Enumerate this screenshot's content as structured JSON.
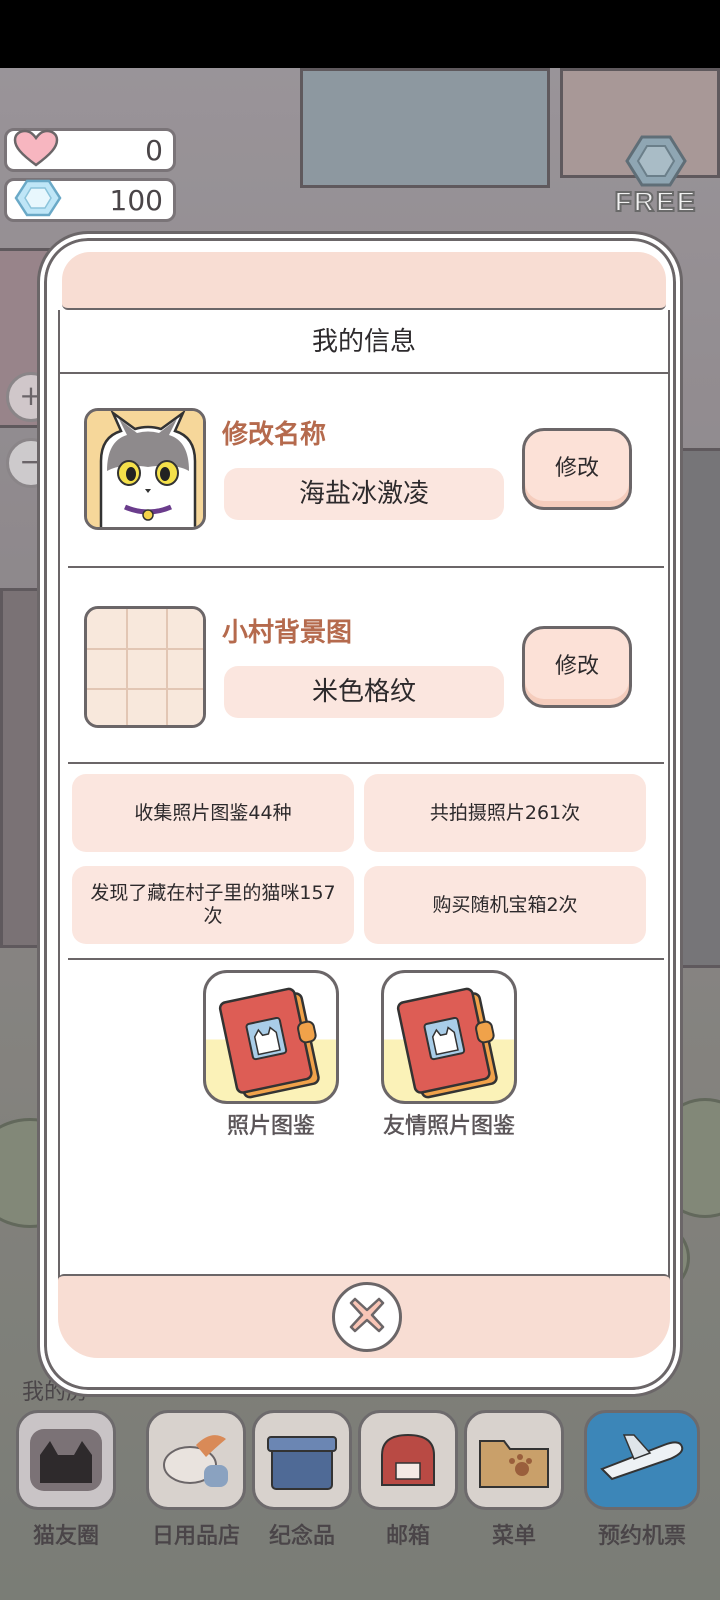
{
  "currency": {
    "hearts": {
      "icon": "heart-icon",
      "value": "0"
    },
    "gems": {
      "icon": "diamond-icon",
      "value": "100"
    },
    "free_label": "FREE"
  },
  "zoom": {
    "plus": "+",
    "minus": "−"
  },
  "modal": {
    "title": "我的信息",
    "name_setting": {
      "title": "修改名称",
      "value": "海盐冰激凌",
      "button": "修改"
    },
    "background_setting": {
      "title": "小村背景图",
      "value": "米色格纹",
      "button": "修改"
    },
    "stats": [
      "收集照片图鉴44种",
      "共拍摄照片261次",
      "发现了藏在村子里的猫咪157次",
      "购买随机宝箱2次"
    ],
    "books": [
      {
        "label": "照片图鉴",
        "icon": "photo-album-icon"
      },
      {
        "label": "友情照片图鉴",
        "icon": "photo-album-icon"
      }
    ],
    "close_icon": "close-icon"
  },
  "bottom_nav": {
    "my_room_label": "我的房",
    "items": [
      {
        "label": "猫友圈",
        "icon": "cat-camera-icon"
      },
      {
        "label": "日用品店",
        "icon": "shop-icon"
      },
      {
        "label": "纪念品",
        "icon": "souvenir-box-icon"
      },
      {
        "label": "邮箱",
        "icon": "mailbox-icon"
      },
      {
        "label": "菜单",
        "icon": "folder-icon"
      },
      {
        "label": "预约机票",
        "icon": "airplane-icon"
      }
    ]
  },
  "colors": {
    "modal_header": "#f8ddd3",
    "pill": "#fbe6df",
    "accent_title": "#b56a4d",
    "outline": "#6b6668"
  }
}
